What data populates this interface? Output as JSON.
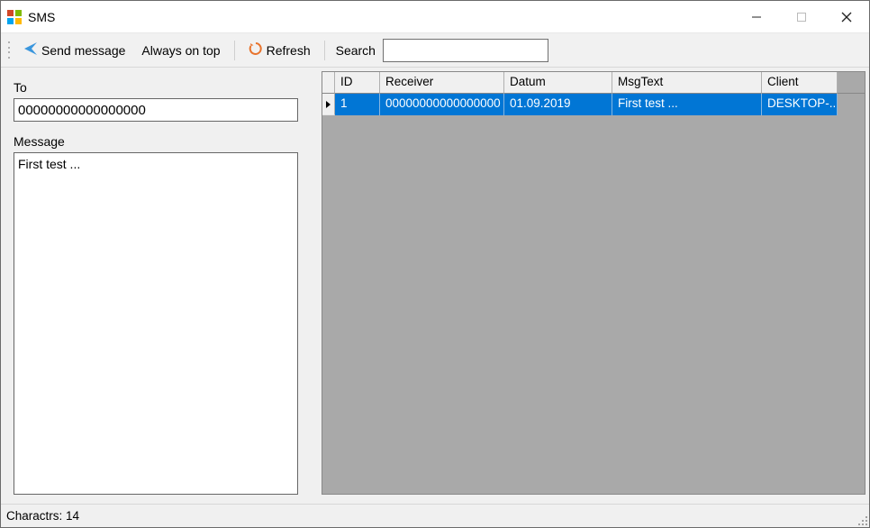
{
  "window": {
    "title": "SMS"
  },
  "toolbar": {
    "send_label": "Send message",
    "always_on_top_label": "Always on top",
    "refresh_label": "Refresh",
    "search_label": "Search",
    "search_value": ""
  },
  "form": {
    "to_label": "To",
    "to_value": "00000000000000000",
    "message_label": "Message",
    "message_value": "First test ..."
  },
  "grid": {
    "columns": {
      "id": "ID",
      "receiver": "Receiver",
      "datum": "Datum",
      "msgtext": "MsgText",
      "client": "Client"
    },
    "rows": [
      {
        "id": "1",
        "receiver": "00000000000000000",
        "datum": "01.09.2019",
        "msgtext": "First test ...",
        "client": "DESKTOP-..."
      }
    ]
  },
  "status": {
    "chars_label": "Charactrs: 14"
  }
}
